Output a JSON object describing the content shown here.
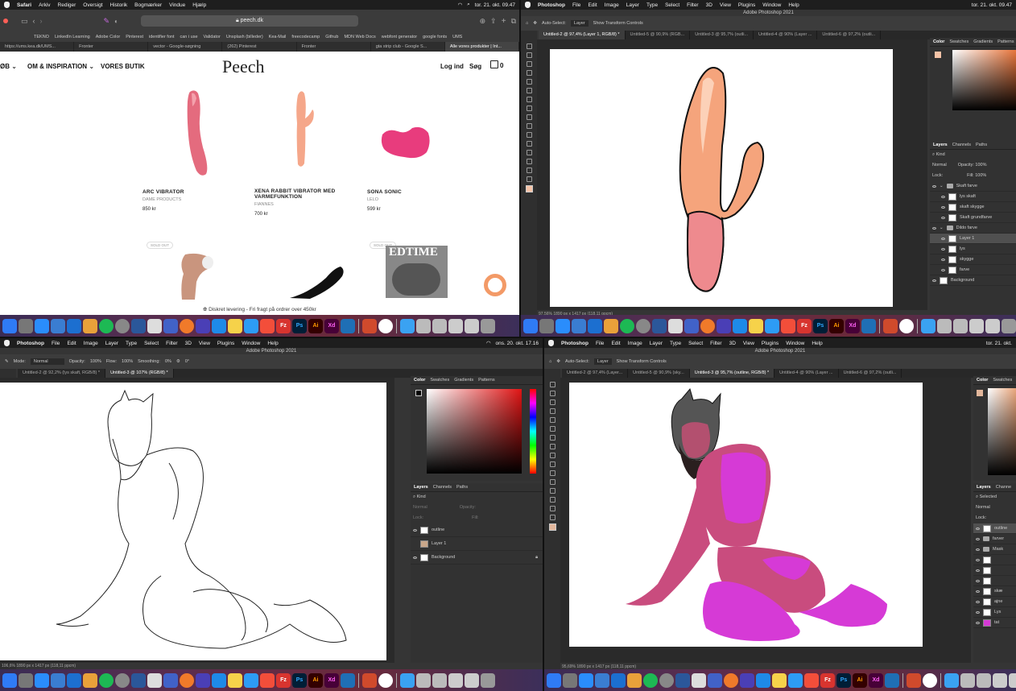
{
  "q1": {
    "menubar": {
      "app": "Safari",
      "items": [
        "Arkiv",
        "Rediger",
        "Oversigt",
        "Historik",
        "Bogmærker",
        "Vindue",
        "Hjælp"
      ],
      "clock": "tor. 21. okt. 09.47"
    },
    "url": "peech.dk",
    "bookmarks": [
      "TEKNO",
      "LinkedIn Learning",
      "Adobe Color",
      "Pinterest",
      "identifier font",
      "can i use",
      "Validator",
      "Unsplash (billeder)",
      "Kea-Mail",
      "freecodecamp",
      "Github",
      "MDN Web Docs",
      "webfont generator",
      "google fonts",
      "UMS"
    ],
    "tabs": [
      "https://ums.kea.dk/UMS...",
      "Fronter",
      "vector - Google-søgning",
      "(262) Pinterest",
      "Fronter",
      "gta strip club - Google S...",
      "Alle vores produkter | Int..."
    ],
    "nav": {
      "shop": "ØB",
      "inspiration": "OM & INSPIRATION",
      "store": "VORES BUTIK",
      "logo": "Peech",
      "login": "Log ind",
      "search": "Søg",
      "cart_count": "0"
    },
    "products": [
      {
        "title": "ARC VIBRATOR",
        "brand": "DAME PRODUCTS",
        "price": "850 kr"
      },
      {
        "title": "XENA RABBIT VIBRATOR MED VARMEFUNKTION",
        "brand": "FIANNES",
        "price": "700 kr"
      },
      {
        "title": "SONA SONIC",
        "brand": "LELO",
        "price": "599 kr"
      }
    ],
    "sold_out": "SOLD OUT",
    "book_title": "EDTIME",
    "promo": "Diskret levering - Fri fragt på ordrer over 450kr"
  },
  "q2": {
    "menubar": {
      "app": "Photoshop",
      "items": [
        "File",
        "Edit",
        "Image",
        "Layer",
        "Type",
        "Select",
        "Filter",
        "3D",
        "View",
        "Plugins",
        "Window",
        "Help"
      ],
      "clock": "tor. 21. okt. 09.47"
    },
    "title": "Adobe Photoshop 2021",
    "options": [
      "Auto-Select:",
      "Layer",
      "Show Transform Controls"
    ],
    "doc_tabs": [
      "Untitled-2 @ 97,4% (Layer 1, RGB/8) *",
      "Untitled-5 @ 90,9% (RGB...",
      "Untitled-3 @ 95,7% (outli...",
      "Untitled-4 @ 90% (Layer ...",
      "Untitled-6 @ 97,2% (outli..."
    ],
    "panel_tabs": [
      "Color",
      "Swatches",
      "Gradients",
      "Patterns"
    ],
    "layer_tabs": [
      "Layers",
      "Channels",
      "Paths"
    ],
    "kind": "Kind",
    "blend": "Normal",
    "opacity": "Opacity: 100%",
    "fill": "Fill: 100%",
    "lock": "Lock:",
    "layers": [
      "Skaft farve",
      "lys skaft",
      "skaft skygge",
      "Skaft grundfarve",
      "Dildo farve",
      "Layer 1",
      "lys",
      "skygge",
      "farve",
      "Background"
    ],
    "status": "97,56%   1890 px x 1417 px (118,11 ppcm)"
  },
  "q3": {
    "menubar": {
      "app": "Photoshop",
      "items": [
        "File",
        "Edit",
        "Image",
        "Layer",
        "Type",
        "Select",
        "Filter",
        "3D",
        "View",
        "Plugins",
        "Window",
        "Help"
      ],
      "clock": "ons. 20. okt. 17.16"
    },
    "title": "Adobe Photoshop 2021",
    "options": [
      "Mode:",
      "Normal",
      "Opacity:",
      "100%",
      "Flow:",
      "100%",
      "Smoothing:",
      "0%",
      "0°"
    ],
    "doc_tabs": [
      "Untitled-2 @ 92,2% (lys skaft, RGB/8) *",
      "Untitled-3 @ 107% (RGB/8) *"
    ],
    "panel_tabs": [
      "Color",
      "Swatches",
      "Gradients",
      "Patterns"
    ],
    "layer_tabs": [
      "Layers",
      "Channels",
      "Paths"
    ],
    "kind": "Kind",
    "blend": "Normal",
    "opacity": "Opacity:",
    "lock": "Lock:",
    "fill": "Fill:",
    "layers": [
      "outline",
      "Layer 1",
      "Background"
    ],
    "status": "106,6%   1890 px x 1417 px (118,11 ppcm)"
  },
  "q4": {
    "menubar": {
      "app": "Photoshop",
      "items": [
        "File",
        "Edit",
        "Image",
        "Layer",
        "Type",
        "Select",
        "Filter",
        "3D",
        "View",
        "Plugins",
        "Window",
        "Help"
      ],
      "clock": "tor. 21. okt."
    },
    "title": "Adobe Photoshop 2021",
    "options": [
      "Auto-Select:",
      "Layer",
      "Show Transform Controls"
    ],
    "doc_tabs": [
      "Untitled-2 @ 97,4% (Layer...",
      "Untitled-5 @ 90,9% (sky...",
      "Untitled-3 @ 95,7% (outline, RGB/8) *",
      "Untitled-4 @ 90% (Layer ...",
      "Untitled-6 @ 97,2% (outli..."
    ],
    "panel_tabs": [
      "Color",
      "Swatches"
    ],
    "layer_tabs": [
      "Layers",
      "Channe"
    ],
    "kind": "Selected",
    "blend": "Normal",
    "lock": "Lock:",
    "layers": [
      "outline",
      "farver",
      "Mask",
      "skæ",
      "ajne",
      "Lys",
      "tat"
    ],
    "status": "95,69%   1890 px x 1417 px (118,11 ppcm)"
  },
  "dock_labels": {
    "ps": "Ps",
    "ai": "Ai",
    "xd": "Xd",
    "fz": "Fz"
  },
  "colors": {
    "peach_pink": "#f26f9a",
    "sonic_pink": "#e83c7d",
    "skin_magenta": "#c94c7e",
    "clothes_magenta": "#d63ad6",
    "vibe_orange": "#f5a47c",
    "vibe_pink": "#ee8a8e"
  }
}
